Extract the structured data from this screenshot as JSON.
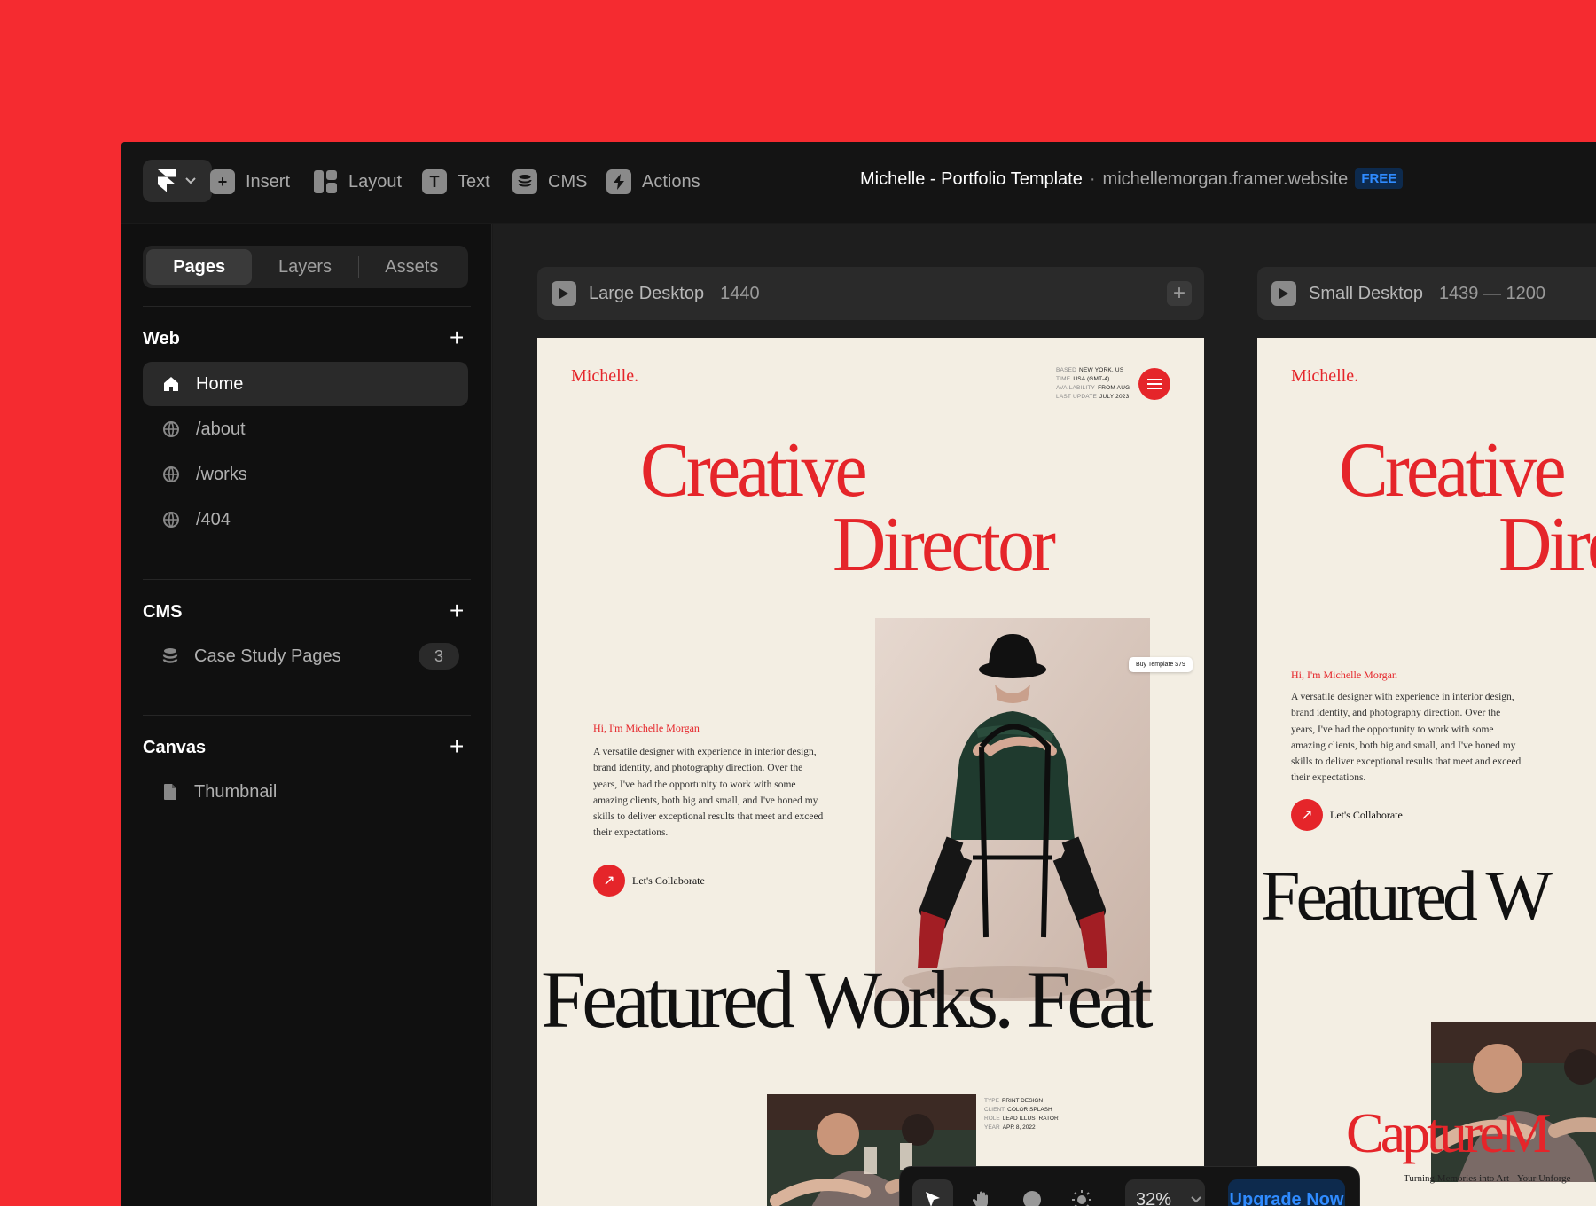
{
  "toolbar": {
    "insert": "Insert",
    "layout": "Layout",
    "text": "Text",
    "cms": "CMS",
    "actions": "Actions",
    "project_title": "Michelle - Portfolio Template",
    "separator": "·",
    "site_url": "michellemorgan.framer.website",
    "plan_badge": "FREE"
  },
  "sidebar": {
    "tabs": [
      "Pages",
      "Layers",
      "Assets"
    ],
    "web": {
      "title": "Web",
      "items": [
        {
          "label": "Home",
          "icon": "home-icon"
        },
        {
          "label": "/about",
          "icon": "globe-icon"
        },
        {
          "label": "/works",
          "icon": "globe-icon"
        },
        {
          "label": "/404",
          "icon": "globe-icon"
        }
      ]
    },
    "cms": {
      "title": "CMS",
      "items": [
        {
          "label": "Case Study Pages",
          "count": "3",
          "icon": "database-icon"
        }
      ]
    },
    "canvas": {
      "title": "Canvas",
      "items": [
        {
          "label": "Thumbnail",
          "icon": "file-icon"
        }
      ]
    }
  },
  "frames": [
    {
      "name": "Large Desktop",
      "size": "1440"
    },
    {
      "name": "Small Desktop",
      "size": "1439 — 1200"
    }
  ],
  "site": {
    "brand": "Michelle.",
    "meta": [
      {
        "k": "BASED",
        "v": "NEW YORK, US"
      },
      {
        "k": "TIME",
        "v": "USA (GMT-4)"
      },
      {
        "k": "AVAILABILITY",
        "v": "FROM AUG"
      },
      {
        "k": "LAST UPDATE",
        "v": "JULY 2023"
      }
    ],
    "headline_1": "Creative",
    "headline_2": "Director",
    "headline_2_partial": "Dire",
    "intro_heading": "Hi, I'm Michelle Morgan",
    "intro_body": "A versatile designer with experience in interior design, brand identity, and photography direction. Over the years, I've had the opportunity to work with some amazing clients, both big and small, and I've honed my skills to deliver exceptional results that meet and exceed their expectations.",
    "cta": "Let's Collaborate",
    "buy_tag": "Buy Template $79",
    "featured": "Featured Works. Feat",
    "featured_small": "Featured W",
    "work_meta": [
      {
        "k": "TYPE",
        "v": "PRINT DESIGN"
      },
      {
        "k": "CLIENT",
        "v": "COLOR SPLASH"
      },
      {
        "k": "ROLE",
        "v": "LEAD ILLUSTRATOR"
      },
      {
        "k": "YEAR",
        "v": "APR 8, 2022"
      }
    ],
    "capture": "CaptureM",
    "tagline": "Turning Memories into Art - Your Unforge"
  },
  "bottom_bar": {
    "zoom": "32%",
    "upgrade": "Upgrade Now"
  },
  "colors": {
    "background": "#f52b30",
    "accent_red": "#e5252a",
    "badge_blue": "#2f8bff",
    "page_cream": "#f3eee3"
  }
}
